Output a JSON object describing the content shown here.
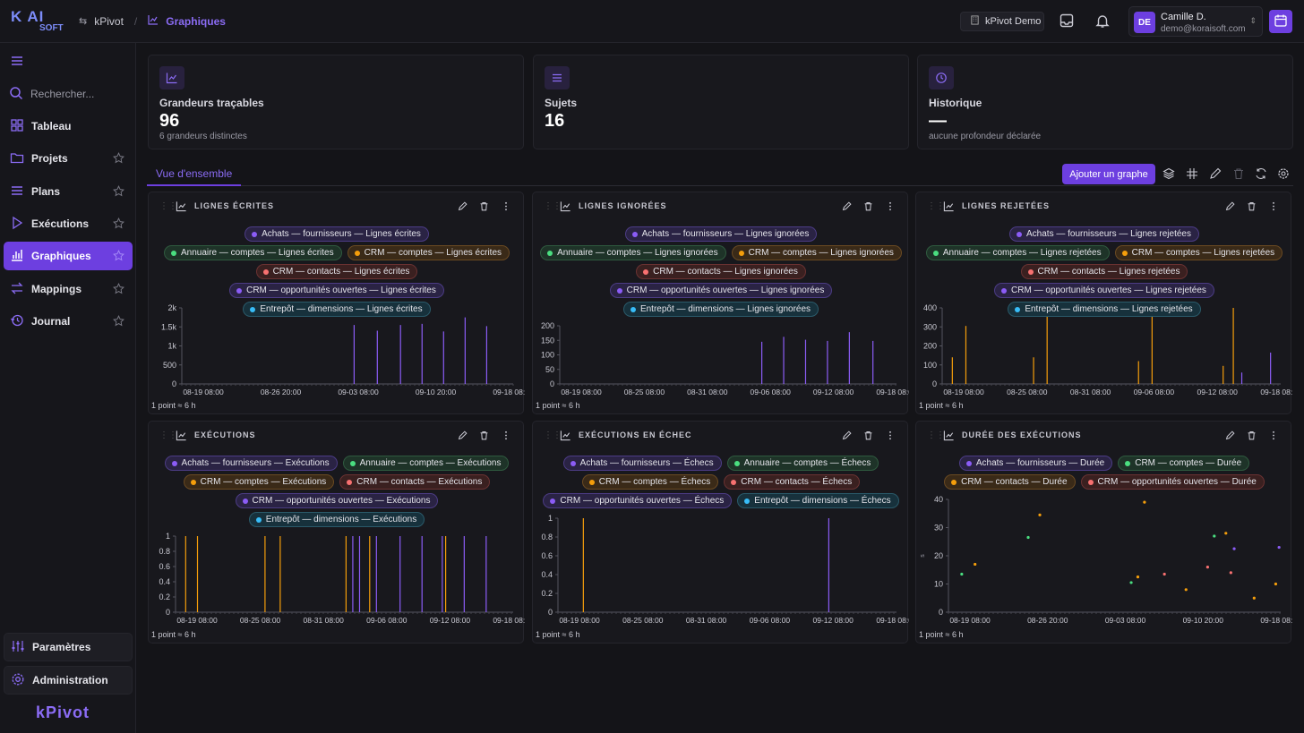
{
  "app": {
    "logo_top": "K AI",
    "logo_bottom": "SOFT",
    "brand": "kPivot"
  },
  "breadcrumb": {
    "root": "kPivot",
    "current": "Graphiques"
  },
  "topbar": {
    "tenant": "kPivot Demo",
    "user_initials": "DE",
    "user_name": "Camille D.",
    "user_email": "demo@koraisoft.com"
  },
  "sidebar": {
    "search_placeholder": "Rechercher...",
    "items": [
      {
        "label": "Tableau",
        "icon": "grid-icon"
      },
      {
        "label": "Projets",
        "icon": "folder-icon"
      },
      {
        "label": "Plans",
        "icon": "list-icon"
      },
      {
        "label": "Exécutions",
        "icon": "play-icon"
      },
      {
        "label": "Graphiques",
        "icon": "bar-chart-icon"
      },
      {
        "label": "Mappings",
        "icon": "arrows-icon"
      },
      {
        "label": "Journal",
        "icon": "history-icon"
      }
    ],
    "settings": "Paramètres",
    "admin": "Administration"
  },
  "stats": [
    {
      "label": "Grandeurs traçables",
      "value": "96",
      "sub": "6 grandeurs distinctes"
    },
    {
      "label": "Sujets",
      "value": "16",
      "sub": ""
    },
    {
      "label": "Historique",
      "value": "—",
      "sub": "aucune profondeur déclarée"
    }
  ],
  "tabs": {
    "overview": "Vue d'ensemble"
  },
  "toolbar": {
    "add_graph": "Ajouter un graphe"
  },
  "colors": {
    "accent": "#6d3fe0",
    "purple": "#8b5cf6",
    "green": "#4ade80",
    "orange": "#f59e0b",
    "red": "#f87171",
    "cyan": "#38bdf8"
  },
  "footer_note": "1 point ≈ 6 h",
  "chart_data": [
    {
      "type": "bar",
      "title": "LIGNES ÉCRITES",
      "legend": [
        {
          "name": "Achats — fournisseurs — Lignes écrites",
          "color": "purple"
        },
        {
          "name": "Annuaire — comptes — Lignes écrites",
          "color": "green"
        },
        {
          "name": "CRM — comptes — Lignes écrites",
          "color": "orange"
        },
        {
          "name": "CRM — contacts — Lignes écrites",
          "color": "red"
        },
        {
          "name": "CRM — opportunités ouvertes — Lignes écrites",
          "color": "purple"
        },
        {
          "name": "Entrepôt — dimensions — Lignes écrites",
          "color": "cyan"
        }
      ],
      "yticks": [
        "0",
        "500",
        "1k",
        "1.5k",
        "2k"
      ],
      "ylim": [
        0,
        2000
      ],
      "xticks": [
        "08-19 08:00",
        "08-26 20:00",
        "09-03 08:00",
        "09-10 20:00",
        "09-18 08:00"
      ],
      "xlim": [
        0,
        100
      ],
      "bars": [
        {
          "x": 52,
          "y": 1550
        },
        {
          "x": 59,
          "y": 1400
        },
        {
          "x": 66,
          "y": 1550
        },
        {
          "x": 72.5,
          "y": 1580
        },
        {
          "x": 79,
          "y": 1380
        },
        {
          "x": 85.5,
          "y": 1750
        },
        {
          "x": 92,
          "y": 1520
        }
      ]
    },
    {
      "type": "bar",
      "title": "LIGNES IGNORÉES",
      "legend": [
        {
          "name": "Achats — fournisseurs — Lignes ignorées",
          "color": "purple"
        },
        {
          "name": "Annuaire — comptes — Lignes ignorées",
          "color": "green"
        },
        {
          "name": "CRM — comptes — Lignes ignorées",
          "color": "orange"
        },
        {
          "name": "CRM — contacts — Lignes ignorées",
          "color": "red"
        },
        {
          "name": "CRM — opportunités ouvertes — Lignes ignorées",
          "color": "purple"
        },
        {
          "name": "Entrepôt — dimensions — Lignes ignorées",
          "color": "cyan"
        }
      ],
      "yticks": [
        "0",
        "50",
        "100",
        "150",
        "200"
      ],
      "ylim": [
        0,
        200
      ],
      "xticks": [
        "08-19 08:00",
        "08-25 08:00",
        "08-31 08:00",
        "09-06 08:00",
        "09-12 08:00",
        "09-18 08:00"
      ],
      "xlim": [
        0,
        100
      ],
      "bars": [
        {
          "x": 60,
          "y": 145
        },
        {
          "x": 66.5,
          "y": 162
        },
        {
          "x": 73,
          "y": 152
        },
        {
          "x": 79.5,
          "y": 148
        },
        {
          "x": 86,
          "y": 178
        },
        {
          "x": 93,
          "y": 148
        }
      ]
    },
    {
      "type": "bar",
      "title": "LIGNES REJETÉES",
      "legend": [
        {
          "name": "Achats — fournisseurs — Lignes rejetées",
          "color": "purple"
        },
        {
          "name": "Annuaire — comptes — Lignes rejetées",
          "color": "green"
        },
        {
          "name": "CRM — comptes — Lignes rejetées",
          "color": "orange"
        },
        {
          "name": "CRM — contacts — Lignes rejetées",
          "color": "red"
        },
        {
          "name": "CRM — opportunités ouvertes — Lignes rejetées",
          "color": "purple"
        },
        {
          "name": "Entrepôt — dimensions — Lignes rejetées",
          "color": "cyan"
        }
      ],
      "yticks": [
        "0",
        "100",
        "200",
        "300",
        "400"
      ],
      "ylim": [
        0,
        400
      ],
      "xticks": [
        "08-19 08:00",
        "08-25 08:00",
        "08-31 08:00",
        "09-06 08:00",
        "09-12 08:00",
        "09-18 08:00"
      ],
      "xlim": [
        0,
        100
      ],
      "bars": [
        {
          "x": 3,
          "y": 140,
          "c": "orange"
        },
        {
          "x": 7,
          "y": 305,
          "c": "orange"
        },
        {
          "x": 27,
          "y": 140,
          "c": "orange"
        },
        {
          "x": 31,
          "y": 398,
          "c": "orange"
        },
        {
          "x": 58,
          "y": 120,
          "c": "orange"
        },
        {
          "x": 62,
          "y": 400,
          "c": "orange"
        },
        {
          "x": 83,
          "y": 95,
          "c": "orange"
        },
        {
          "x": 86,
          "y": 400,
          "c": "orange"
        },
        {
          "x": 88.5,
          "y": 60,
          "c": "purple"
        },
        {
          "x": 97,
          "y": 165,
          "c": "purple"
        }
      ]
    },
    {
      "type": "bar",
      "title": "EXÉCUTIONS",
      "legend": [
        {
          "name": "Achats — fournisseurs — Exécutions",
          "color": "purple"
        },
        {
          "name": "Annuaire — comptes — Exécutions",
          "color": "green"
        },
        {
          "name": "CRM — comptes — Exécutions",
          "color": "orange"
        },
        {
          "name": "CRM — contacts — Exécutions",
          "color": "red"
        },
        {
          "name": "CRM — opportunités ouvertes — Exécutions",
          "color": "purple"
        },
        {
          "name": "Entrepôt — dimensions — Exécutions",
          "color": "cyan"
        }
      ],
      "yticks": [
        "0",
        "0.2",
        "0.4",
        "0.6",
        "0.8",
        "1"
      ],
      "ylim": [
        0,
        1
      ],
      "xticks": [
        "08-19 08:00",
        "08-25 08:00",
        "08-31 08:00",
        "09-06 08:00",
        "09-12 08:00",
        "09-18 08:00"
      ],
      "xlim": [
        0,
        100
      ],
      "bars": [
        {
          "x": 3,
          "y": 1,
          "c": "orange"
        },
        {
          "x": 6.5,
          "y": 1,
          "c": "orange"
        },
        {
          "x": 26.5,
          "y": 1,
          "c": "orange"
        },
        {
          "x": 31,
          "y": 1,
          "c": "orange"
        },
        {
          "x": 50.5,
          "y": 1,
          "c": "orange"
        },
        {
          "x": 52.5,
          "y": 1,
          "c": "purple"
        },
        {
          "x": 54.5,
          "y": 1,
          "c": "purple"
        },
        {
          "x": 57.5,
          "y": 1,
          "c": "orange"
        },
        {
          "x": 59.5,
          "y": 1,
          "c": "purple"
        },
        {
          "x": 66.5,
          "y": 1,
          "c": "purple"
        },
        {
          "x": 73,
          "y": 1,
          "c": "purple"
        },
        {
          "x": 79,
          "y": 1,
          "c": "purple"
        },
        {
          "x": 80,
          "y": 1,
          "c": "orange"
        },
        {
          "x": 85.5,
          "y": 1,
          "c": "purple"
        },
        {
          "x": 92,
          "y": 1,
          "c": "purple"
        }
      ]
    },
    {
      "type": "bar",
      "title": "EXÉCUTIONS EN ÉCHEC",
      "legend": [
        {
          "name": "Achats — fournisseurs — Échecs",
          "color": "purple"
        },
        {
          "name": "Annuaire — comptes — Échecs",
          "color": "green"
        },
        {
          "name": "CRM — comptes — Échecs",
          "color": "orange"
        },
        {
          "name": "CRM — contacts — Échecs",
          "color": "red"
        },
        {
          "name": "CRM — opportunités ouvertes — Échecs",
          "color": "purple"
        },
        {
          "name": "Entrepôt — dimensions — Échecs",
          "color": "cyan"
        }
      ],
      "yticks": [
        "0",
        "0.2",
        "0.4",
        "0.6",
        "0.8",
        "1"
      ],
      "ylim": [
        0,
        1
      ],
      "xticks": [
        "08-19 08:00",
        "08-25 08:00",
        "08-31 08:00",
        "09-06 08:00",
        "09-12 08:00",
        "09-18 08:00"
      ],
      "xlim": [
        0,
        100
      ],
      "bars": [
        {
          "x": 7.5,
          "y": 1,
          "c": "orange"
        },
        {
          "x": 80,
          "y": 1,
          "c": "purple"
        }
      ]
    },
    {
      "type": "scatter",
      "title": "DURÉE DES EXÉCUTIONS",
      "legend": [
        {
          "name": "Achats — fournisseurs — Durée",
          "color": "purple"
        },
        {
          "name": "CRM — comptes — Durée",
          "color": "green"
        },
        {
          "name": "CRM — contacts — Durée",
          "color": "orange"
        },
        {
          "name": "CRM — opportunités ouvertes — Durée",
          "color": "red"
        }
      ],
      "ylabel": "s",
      "yticks": [
        "0",
        "10",
        "20",
        "30",
        "40"
      ],
      "ylim": [
        0,
        40
      ],
      "xticks": [
        "08-19 08:00",
        "08-26 20:00",
        "09-03 08:00",
        "09-10 20:00",
        "09-18 08:00"
      ],
      "xlim": [
        0,
        100
      ],
      "points": [
        {
          "x": 4,
          "y": 13.5,
          "c": "green"
        },
        {
          "x": 8,
          "y": 17,
          "c": "orange"
        },
        {
          "x": 24,
          "y": 26.5,
          "c": "green"
        },
        {
          "x": 27.5,
          "y": 34.5,
          "c": "orange"
        },
        {
          "x": 55,
          "y": 10.5,
          "c": "green"
        },
        {
          "x": 57,
          "y": 12.5,
          "c": "orange"
        },
        {
          "x": 59,
          "y": 39,
          "c": "orange"
        },
        {
          "x": 65,
          "y": 13.5,
          "c": "red"
        },
        {
          "x": 71.5,
          "y": 8,
          "c": "orange"
        },
        {
          "x": 78,
          "y": 16,
          "c": "red"
        },
        {
          "x": 80,
          "y": 27,
          "c": "green"
        },
        {
          "x": 83.5,
          "y": 28,
          "c": "orange"
        },
        {
          "x": 85,
          "y": 14,
          "c": "red"
        },
        {
          "x": 86,
          "y": 22.5,
          "c": "purple"
        },
        {
          "x": 92,
          "y": 5,
          "c": "orange"
        },
        {
          "x": 98.5,
          "y": 10,
          "c": "orange"
        },
        {
          "x": 99.5,
          "y": 23,
          "c": "purple"
        }
      ]
    }
  ]
}
